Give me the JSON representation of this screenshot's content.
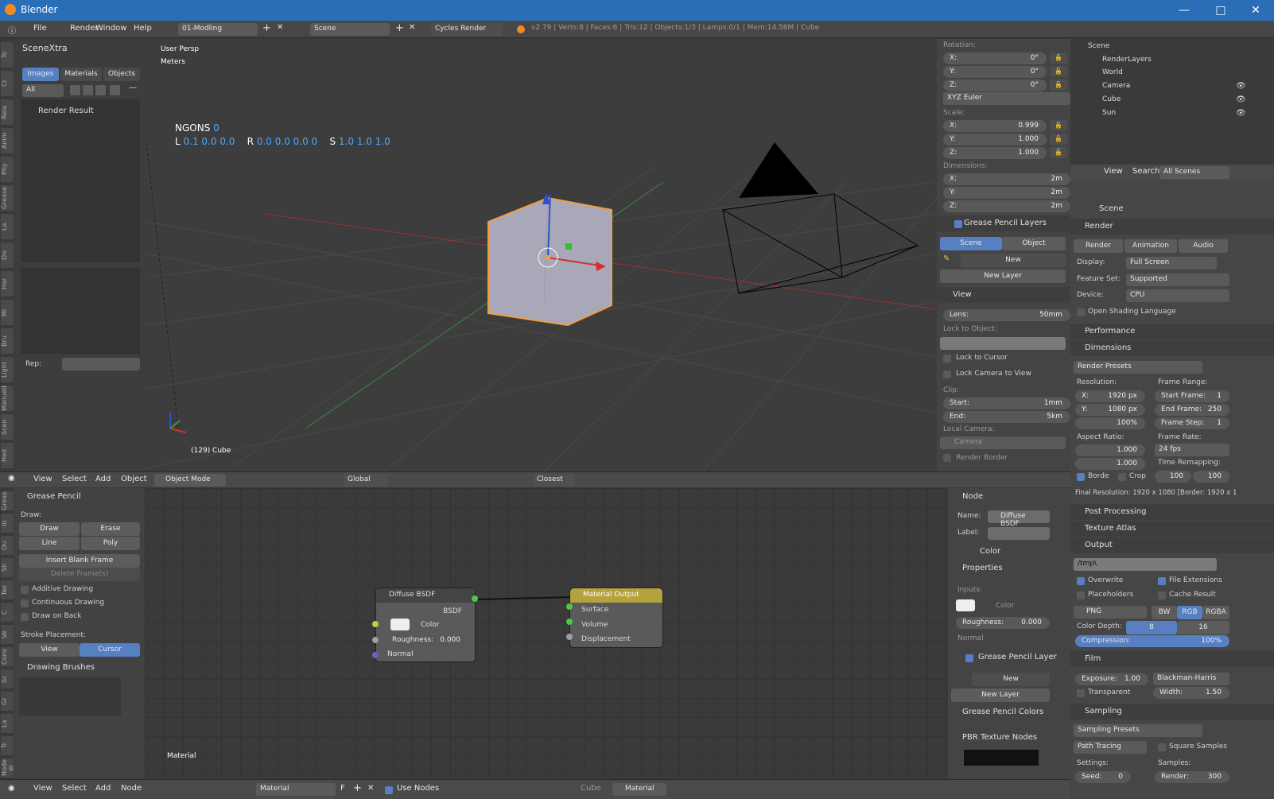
{
  "app": {
    "title": "Blender"
  },
  "menu": {
    "file": "File",
    "render": "Render",
    "window": "Window",
    "help": "Help",
    "layout": "01-Modling",
    "scene": "Scene",
    "engine": "Cycles Render",
    "stats": "v2.79 | Verts:8 | Faces:6 | Tris:12 | Objects:1/3 | Lamps:0/1 | Mem:14.56M | Cube"
  },
  "scenextra": {
    "title": "SceneXtra",
    "tabs": [
      "Images",
      "Materials",
      "Objects"
    ],
    "filter": "All",
    "item": "Render Result",
    "rep": "Rep:"
  },
  "vtabs_left": [
    "To",
    "Cr",
    "Rela",
    "Anim",
    "Phy",
    "Grease",
    "La",
    "Dis",
    "Har",
    "Mi",
    "Bru",
    "Light",
    "ManuelBa",
    "Scen",
    "Hed"
  ],
  "viewport": {
    "persp": "User Persp",
    "units": "Meters",
    "ngons_label": "NGONS",
    "ngons_val": "0",
    "L_label": "L",
    "L_val": "0.1 0.0 0.0",
    "R_label": "R",
    "R_val": "0.0 0.0 0.0 0",
    "S_label": "S",
    "S_val": "1.0 1.0 1.0",
    "object_name": "(129) Cube"
  },
  "npanel": {
    "rotation": "Rotation:",
    "rot": [
      {
        "a": "X:",
        "v": "0°"
      },
      {
        "a": "Y:",
        "v": "0°"
      },
      {
        "a": "Z:",
        "v": "0°"
      }
    ],
    "euler": "XYZ Euler",
    "scale": "Scale:",
    "scl": [
      {
        "a": "X:",
        "v": "0.999"
      },
      {
        "a": "Y:",
        "v": "1.000"
      },
      {
        "a": "Z:",
        "v": "1.000"
      }
    ],
    "dimensions": "Dimensions:",
    "dims": [
      {
        "a": "X:",
        "v": "2m"
      },
      {
        "a": "Y:",
        "v": "2m"
      },
      {
        "a": "Z:",
        "v": "2m"
      }
    ],
    "gp_layers": "Grease Pencil Layers",
    "scene_btn": "Scene",
    "object_btn": "Object",
    "new": "New",
    "new_layer": "New Layer",
    "view": "View",
    "lens_label": "Lens:",
    "lens_val": "50mm",
    "lock_to_object": "Lock to Object:",
    "lock_to_cursor": "Lock to Cursor",
    "lock_cam": "Lock Camera to View",
    "clip": "Clip:",
    "start_label": "Start:",
    "start_val": "1mm",
    "end_label": "End:",
    "end_val": "5km",
    "local_camera": "Local Camera:",
    "camera": "Camera",
    "render_border": "Render Border"
  },
  "view3d_header": {
    "view": "View",
    "select": "Select",
    "add": "Add",
    "object": "Object",
    "mode": "Object Mode",
    "orientation": "Global",
    "snap": "Closest"
  },
  "outliner": {
    "scene": "Scene",
    "items": [
      {
        "name": "RenderLayers"
      },
      {
        "name": "World"
      },
      {
        "name": "Camera"
      },
      {
        "name": "Cube"
      },
      {
        "name": "Sun"
      }
    ],
    "view": "View",
    "search": "Search",
    "filter": "All Scenes"
  },
  "props": {
    "scene": "Scene",
    "render": "Render",
    "tabs": [
      "Render",
      "Animation",
      "Audio"
    ],
    "display_label": "Display:",
    "display_val": "Full Screen",
    "feature_label": "Feature Set:",
    "feature_val": "Supported",
    "device_label": "Device:",
    "device_val": "CPU",
    "osl": "Open Shading Language",
    "performance": "Performance",
    "dimensions": "Dimensions",
    "presets": "Render Presets",
    "resolution": "Resolution:",
    "res_x_l": "X:",
    "res_x": "1920 px",
    "res_y_l": "Y:",
    "res_y": "1080 px",
    "res_pct": "100%",
    "frame_range": "Frame Range:",
    "start_frame_l": "Start Frame:",
    "start_frame": "1",
    "end_frame_l": "End Frame:",
    "end_frame": "250",
    "frame_step_l": "Frame Step:",
    "frame_step": "1",
    "aspect": "Aspect Ratio:",
    "asp_x": "1.000",
    "asp_y": "1.000",
    "frame_rate": "Frame Rate:",
    "fps": "24 fps",
    "time_remap": "Time Remapping:",
    "remap_a": "100",
    "remap_b": "100",
    "border": "Borde",
    "crop": "Crop",
    "final_res": "Final Resolution: 1920 x 1080 [Border: 1920 x 1",
    "post": "Post Processing",
    "atlas": "Texture Atlas",
    "output": "Output",
    "path": "/tmp\\",
    "overwrite": "Overwrite",
    "file_ext": "File Extensions",
    "placeholders": "Placeholders",
    "cache": "Cache Result",
    "format": "PNG",
    "bw": "BW",
    "rgb": "RGB",
    "rgba": "RGBA",
    "depth_label": "Color Depth:",
    "depth8": "8",
    "depth16": "16",
    "compression": "Compression:",
    "compression_val": "100%",
    "film": "Film",
    "exposure_l": "Exposure:",
    "exposure": "1.00",
    "filter": "Blackman-Harris",
    "transparent": "Transparent",
    "width_l": "Width:",
    "width": "1.50",
    "sampling": "Sampling",
    "sampling_presets": "Sampling Presets",
    "path_tracing": "Path Tracing",
    "square": "Square Samples",
    "settings": "Settings:",
    "samples": "Samples:",
    "seed_l": "Seed:",
    "seed": "0",
    "render_l": "Render:",
    "render_s": "300"
  },
  "grease": {
    "title": "Grease Pencil",
    "draw": "Draw:",
    "draw_btn": "Draw",
    "erase": "Erase",
    "line": "Line",
    "poly": "Poly",
    "insert": "Insert Blank Frame",
    "delete": "Delete Frame(s)",
    "additive": "Additive Drawing",
    "continuous": "Continuous Drawing",
    "onback": "Draw on Back",
    "stroke": "Stroke Placement:",
    "view": "View",
    "cursor": "Cursor",
    "brushes": "Drawing Brushes"
  },
  "vtabs_node": [
    "Grease",
    "In",
    "Ou",
    "Sh",
    "Tex",
    "C",
    "Ve",
    "Conv",
    "Sc",
    "Gr",
    "La",
    "Tr",
    "Node W"
  ],
  "nodes": {
    "diffuse": {
      "title": "Diffuse BSDF",
      "out": "BSDF",
      "color": "Color",
      "rough_l": "Roughness:",
      "rough": "0.000",
      "normal": "Normal"
    },
    "output": {
      "title": "Material Output",
      "surface": "Surface",
      "volume": "Volume",
      "displacement": "Displacement"
    },
    "tree": "Material"
  },
  "node_npanel": {
    "node": "Node",
    "name_l": "Name:",
    "name": "Diffuse BSDF",
    "label_l": "Label:",
    "color": "Color",
    "properties": "Properties",
    "inputs": "Inputs:",
    "color_in": "Color",
    "rough_l": "Roughness:",
    "rough": "0.000",
    "normal": "Normal",
    "gp_layer": "Grease Pencil Layer",
    "new": "New",
    "new_layer": "New Layer",
    "gp_colors": "Grease Pencil Colors",
    "pbr": "PBR Texture Nodes"
  },
  "node_header": {
    "view": "View",
    "select": "Select",
    "add": "Add",
    "node": "Node",
    "material": "Material",
    "f": "F",
    "use_nodes": "Use Nodes",
    "cube": "Cube",
    "material2": "Material"
  },
  "colors": {
    "accent": "#5680c2",
    "title": "#2a6eb8",
    "selected": "#f0a040"
  }
}
